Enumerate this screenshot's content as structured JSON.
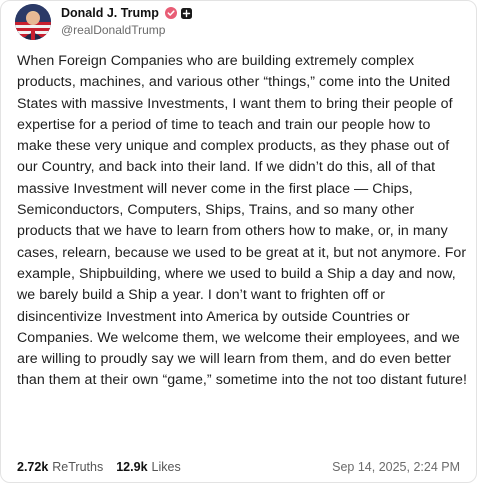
{
  "user": {
    "display_name": "Donald J. Trump",
    "handle": "@realDonaldTrump"
  },
  "post": {
    "text": "When Foreign Companies who are building extremely complex products, machines, and various other “things,” come into the United States with massive Investments, I want them to bring their people of expertise for a period of time to teach and train our people how to make these very unique and complex products, as they phase out of our Country, and back into their land. If we didn’t do this, all of that massive Investment will never come in the first place — Chips, Semiconductors, Computers, Ships, Trains, and so many other products that we have to learn from others how to make, or, in many cases, relearn, because we used to be great at it, but not anymore. For example, Shipbuilding, where we used to build a Ship a day and now, we barely build a Ship a year. I don’t want to frighten off or disincentivize Investment into America by outside Countries or Companies. We welcome them, we welcome their employees, and we are willing to proudly say we will learn from them, and do even better than them at their own “game,” sometime into the not too distant future!"
  },
  "stats": {
    "retruths_count": "2.72k",
    "retruths_label": "ReTruths",
    "likes_count": "12.9k",
    "likes_label": "Likes"
  },
  "timestamp": "Sep 14, 2025, 2:24 PM",
  "colors": {
    "verified_badge": "#e85d75",
    "text": "#1e1e1e",
    "muted": "#6b6b6b"
  },
  "icons": [
    "verified-badge-icon",
    "account-badge-icon"
  ]
}
